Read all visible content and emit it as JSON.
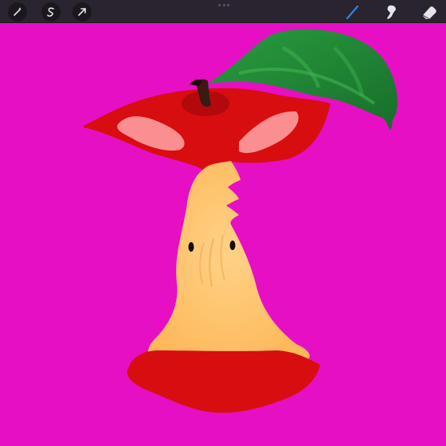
{
  "app": {
    "canvas_color": "#e60fc4",
    "toolbar_color": "#2a2430",
    "accent_color": "#2f7fe0"
  },
  "toolbar": {
    "left_tools": [
      {
        "name": "adjustments-icon"
      },
      {
        "name": "selection-icon"
      },
      {
        "name": "transform-icon"
      }
    ],
    "right_tools": [
      {
        "name": "brush-icon",
        "active": true
      },
      {
        "name": "smudge-icon",
        "active": false
      },
      {
        "name": "eraser-icon",
        "active": false
      }
    ]
  },
  "artwork": {
    "subject": "apple-core",
    "colors": {
      "apple_skin": "#d80d10",
      "core_flesh": "#fdb85a",
      "core_highlight": "#ffd287",
      "leaf": "#1f8a34",
      "stem": "#3a1a12",
      "highlight_pink": "#ff9c9f"
    }
  }
}
